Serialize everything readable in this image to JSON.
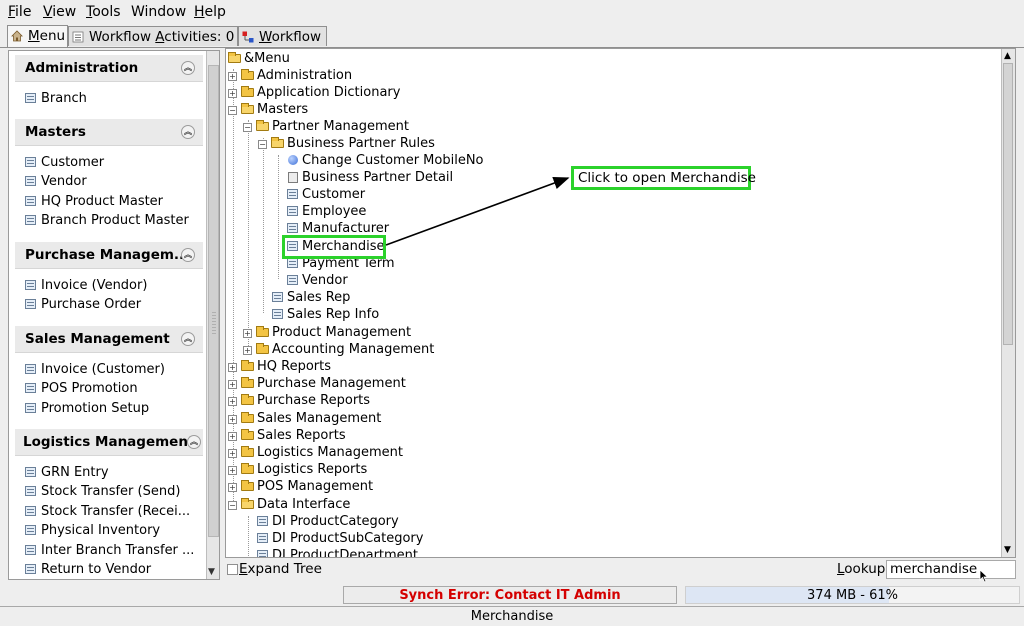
{
  "menubar": {
    "file_pre": "",
    "file_u": "F",
    "file_post": "ile",
    "view_pre": "",
    "view_u": "V",
    "view_post": "iew",
    "tools_pre": "",
    "tools_u": "T",
    "tools_post": "ools",
    "window": "Window",
    "help_pre": "",
    "help_u": "H",
    "help_post": "elp"
  },
  "tabs": {
    "menu_u": "M",
    "menu_post": "enu",
    "workflow_activities_pre": "Workflow ",
    "workflow_activities_u": "A",
    "workflow_activities_post": "ctivities: 0",
    "workflow_u": "W",
    "workflow_post": "orkflow"
  },
  "left_panel": {
    "sections": [
      {
        "title": "Administration",
        "items": [
          "Branch"
        ]
      },
      {
        "title": "Masters",
        "items": [
          "Customer",
          "Vendor",
          "HQ Product Master",
          "Branch Product Master"
        ]
      },
      {
        "title": "Purchase Managem...",
        "items": [
          "Invoice (Vendor)",
          "Purchase Order"
        ]
      },
      {
        "title": "Sales Management",
        "items": [
          "Invoice (Customer)",
          "POS Promotion",
          "Promotion Setup"
        ]
      },
      {
        "title": "Logistics Management",
        "items": [
          "GRN Entry",
          "Stock Transfer (Send)",
          "Stock Transfer (Recei...",
          "Physical Inventory",
          "Inter Branch Transfer ...",
          "Return to Vendor"
        ]
      }
    ]
  },
  "tree": {
    "root": "&Menu",
    "administration": "Administration",
    "application_dictionary": "Application Dictionary",
    "masters": "Masters",
    "partner_management": "Partner Management",
    "business_partner_rules": "Business Partner Rules",
    "change_customer_mobileno": "Change Customer MobileNo",
    "business_partner_detail": "Business Partner Detail",
    "customer": "Customer",
    "employee": "Employee",
    "manufacturer": "Manufacturer",
    "merchandise": "Merchandise",
    "payment_term": "Payment Term",
    "vendor": "Vendor",
    "sales_rep": "Sales Rep",
    "sales_rep_info": "Sales Rep Info",
    "product_management": "Product Management",
    "accounting_management": "Accounting Management",
    "hq_reports": "HQ Reports",
    "purchase_management": "Purchase Management",
    "purchase_reports": "Purchase Reports",
    "sales_management": "Sales Management",
    "sales_reports": "Sales Reports",
    "logistics_management": "Logistics Management",
    "logistics_reports": "Logistics Reports",
    "pos_management": "POS Management",
    "data_interface": "Data Interface",
    "di_productcategory": "DI ProductCategory",
    "di_productsubcategory": "DI ProductSubCategory",
    "di_productdepartment": "DI ProductDepartment"
  },
  "annotation": {
    "callout_text": "Click to open Merchandise"
  },
  "bottom": {
    "expand_tree_u": "E",
    "expand_tree_post": "xpand Tree",
    "lookup_u": "L",
    "lookup_post": "ookup",
    "lookup_value": "merchandise"
  },
  "status": {
    "sync_error": "Synch Error: Contact IT Admin",
    "memory": "374 MB - 61%",
    "memory_fraction": 0.61,
    "footer": "Merchandise"
  },
  "colors": {
    "error_text": "#d40000",
    "highlight": "#2bd22b",
    "memory_bar": "#dde6f4"
  }
}
